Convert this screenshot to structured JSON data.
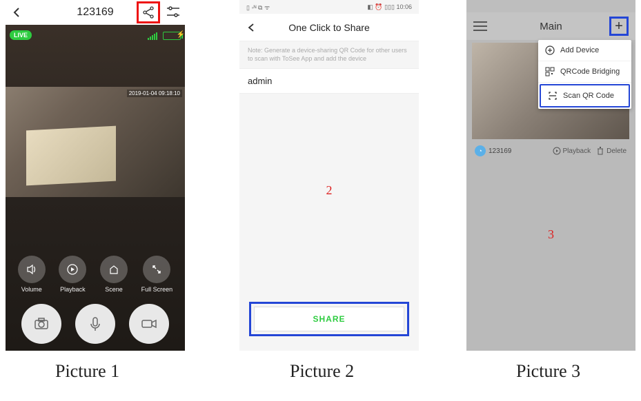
{
  "p1": {
    "device_id": "123169",
    "live_label": "LIVE",
    "timestamp": "2019-01-04 09:18:10",
    "controls": [
      {
        "label": "Volume"
      },
      {
        "label": "Playback"
      },
      {
        "label": "Scene"
      },
      {
        "label": "Full Screen"
      }
    ]
  },
  "p2": {
    "status_time": "10:06",
    "title": "One Click to Share",
    "note": "Note: Generate a device-sharing QR Code for other users to scan with ToSee App and add the device",
    "admin": "admin",
    "share_label": "SHARE",
    "annotation": "2"
  },
  "p3": {
    "title": "Main",
    "dropdown": [
      "Add Device",
      "QRCode Bridging",
      "Scan QR Code"
    ],
    "device_id": "123169",
    "playback_label": "Playback",
    "delete_label": "Delete",
    "annotation": "3"
  },
  "captions": {
    "c1": "Picture 1",
    "c2": "Picture 2",
    "c3": "Picture 3"
  }
}
